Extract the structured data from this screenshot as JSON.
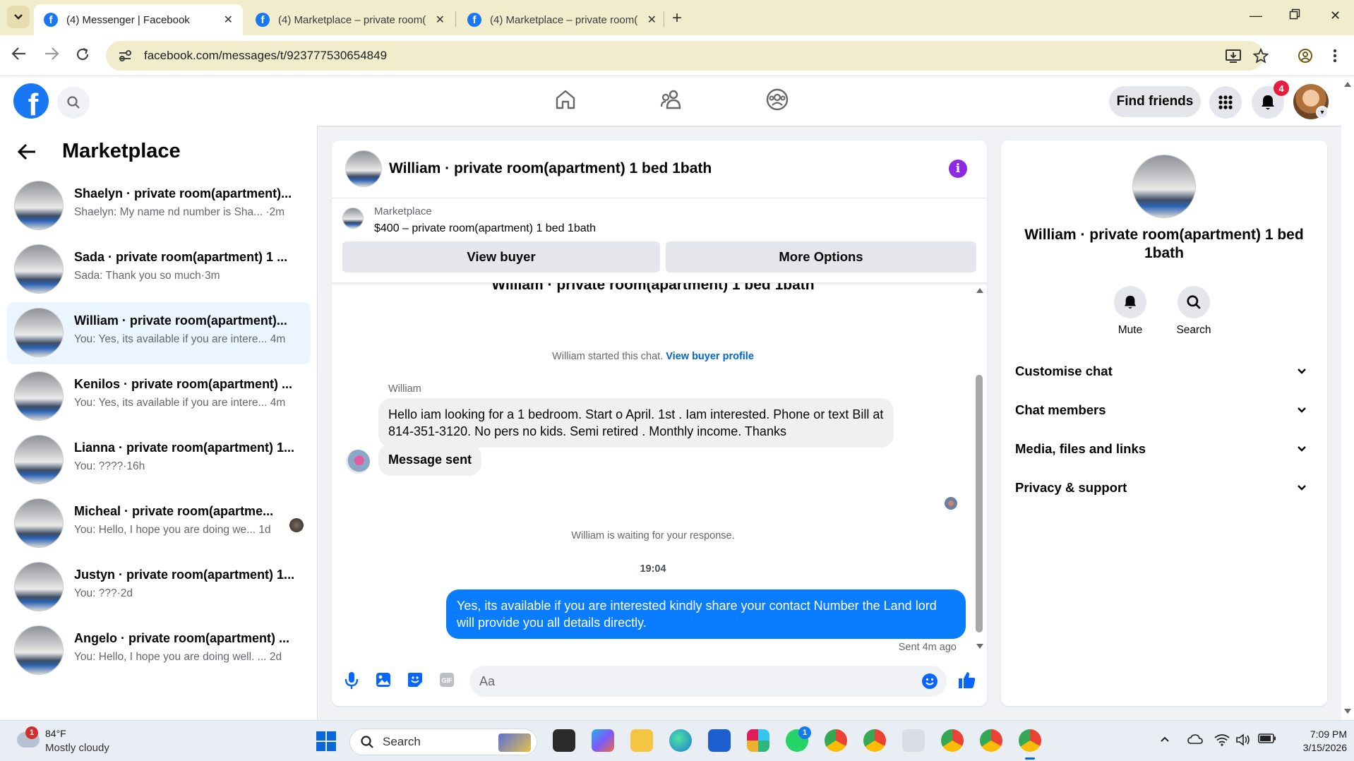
{
  "browser": {
    "tabs": [
      {
        "title": "(4) Messenger | Facebook",
        "active": true
      },
      {
        "title": "(4) Marketplace – private room(",
        "active": false
      },
      {
        "title": "(4) Marketplace – private room(",
        "active": false
      }
    ],
    "url": "facebook.com/messages/t/923777530654849"
  },
  "fb_header": {
    "logo": "f",
    "find_friends": "Find friends",
    "notifications_count": "4"
  },
  "sidebar": {
    "title": "Marketplace",
    "conversations": [
      {
        "name": "Shaelyn · private room(apartment)...",
        "snippet": "Shaelyn: My name nd number is Sha... ·2m",
        "selected": false
      },
      {
        "name": "Sada · private room(apartment) 1 ...",
        "snippet": "Sada: Thank you so much·3m",
        "selected": false
      },
      {
        "name": "William · private room(apartment)...",
        "snippet": "You: Yes, its available if you are intere... 4m",
        "selected": true
      },
      {
        "name": "Kenilos · private room(apartment) ...",
        "snippet": "You: Yes, its available if you are intere... 4m",
        "selected": false
      },
      {
        "name": "Lianna · private room(apartment) 1...",
        "snippet": "You: ????·16h",
        "selected": false
      },
      {
        "name": "Micheal · private room(apartme...",
        "snippet": "You: Hello, I hope you are doing we... 1d",
        "selected": false
      },
      {
        "name": "Justyn · private room(apartment) 1...",
        "snippet": "You: ???·2d",
        "selected": false
      },
      {
        "name": "Angelo · private room(apartment) ...",
        "snippet": "You: Hello, I hope you are doing well. ... 2d",
        "selected": false
      }
    ]
  },
  "chat": {
    "title": "William · private room(apartment) 1 bed 1bath",
    "info_icon": "i",
    "listing": {
      "source": "Marketplace",
      "price_title": "$400 – private room(apartment) 1 bed 1bath",
      "view_buyer": "View buyer",
      "more_options": "More Options"
    },
    "scrolled_title": "William · private room(apartment) 1 bed 1bath",
    "started_text": "William started this chat.",
    "buyer_profile_link": "View buyer profile",
    "sender": "William",
    "incoming_message": "Hello iam looking for a 1 bedroom. Start o April. 1st . Iam interested.  Phone or text Bill at 814-351-3120.  No pers no kids. Semi retired . Monthly income. Thanks",
    "message_sent_label": "Message sent",
    "waiting_text": "William is waiting for your response.",
    "timestamp": "19:04",
    "outgoing_message": "Yes, its available if you are interested kindly share your contact Number the Land lord will provide you all details directly.",
    "sent_status": "Sent 4m ago",
    "composer_placeholder": "Aa"
  },
  "info_panel": {
    "name": "William · private room(apartment) 1 bed 1bath",
    "actions": [
      {
        "label": "Mute",
        "icon": "bell-icon"
      },
      {
        "label": "Search",
        "icon": "search-icon"
      }
    ],
    "sections": [
      "Customise chat",
      "Chat members",
      "Media, files and links",
      "Privacy & support"
    ]
  },
  "taskbar": {
    "weather_badge": "1",
    "temperature": "84°F",
    "condition": "Mostly cloudy",
    "search_label": "Search",
    "whatsapp_badge": "1",
    "time": "7:09 PM",
    "date": "3/15/2026"
  },
  "colors": {
    "brand_blue": "#1877f2",
    "outgoing_bubble": "#0a7cff",
    "selected_row": "#ebf5ff",
    "tabstrip": "#f1eccc",
    "notification_red": "#e41e3f",
    "info_purple": "#8a2be2"
  }
}
